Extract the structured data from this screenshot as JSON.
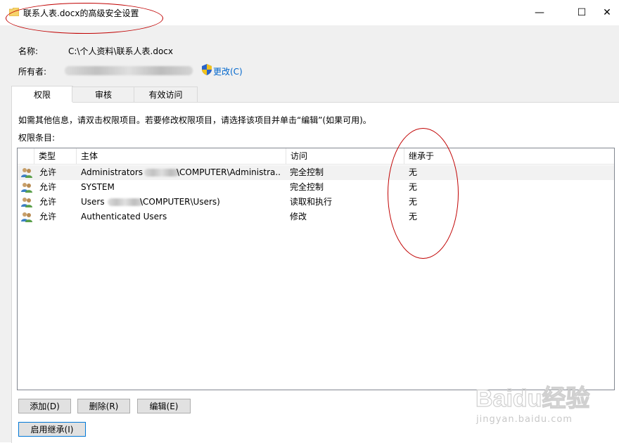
{
  "window": {
    "title": "联系人表.docx的高级安全设置",
    "minimize_glyph": "—",
    "maximize_glyph": "☐",
    "close_glyph": "✕"
  },
  "details": {
    "name_label": "名称:",
    "name_value": "C:\\个人资料\\联系人表.docx",
    "owner_label": "所有者:",
    "change_label": "更改(C)"
  },
  "tabs": [
    {
      "label": "权限",
      "active": true
    },
    {
      "label": "审核",
      "active": false
    },
    {
      "label": "有效访问",
      "active": false
    }
  ],
  "info_text": "如需其他信息，请双击权限项目。若要修改权限项目，请选择该项目并单击“编辑”(如果可用)。",
  "entries_label": "权限条目:",
  "columns": [
    "类型",
    "主体",
    "访问",
    "继承于"
  ],
  "rows": [
    {
      "type": "允许",
      "principal": "Administrators ",
      "principal_tail": "\\COMPUTER\\Administra...",
      "access": "完全控制",
      "inherited": "无"
    },
    {
      "type": "允许",
      "principal": "SYSTEM",
      "principal_tail": "",
      "access": "完全控制",
      "inherited": "无"
    },
    {
      "type": "允许",
      "principal": "Users ",
      "principal_tail": "\\COMPUTER\\Users)",
      "access": "读取和执行",
      "inherited": "无"
    },
    {
      "type": "允许",
      "principal": "Authenticated Users",
      "principal_tail": "",
      "access": "修改",
      "inherited": "无"
    }
  ],
  "buttons": {
    "add": "添加(D)",
    "remove": "删除(R)",
    "edit": "编辑(E)",
    "enable_inheritance": "启用继承(I)"
  },
  "watermark": {
    "text": "jingyan.baidu.com",
    "logo": "Baidu经验"
  },
  "colors": {
    "link": "#0066cc",
    "annotation": "#c00000",
    "selected_row": "#f2f2f2"
  }
}
